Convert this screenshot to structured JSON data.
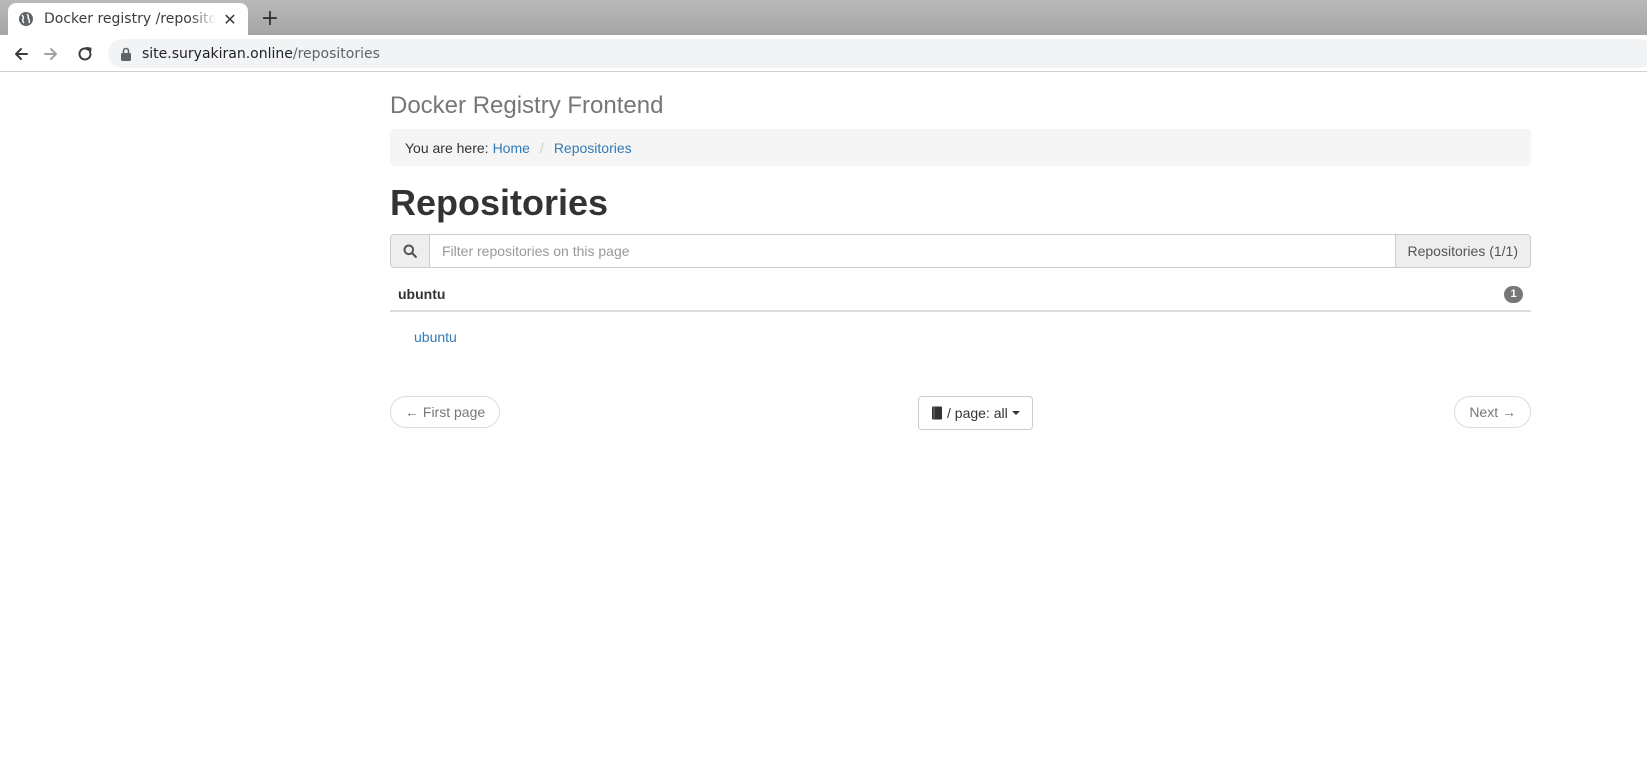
{
  "browser": {
    "tab_title": "Docker registry /repositories",
    "url_host": "site.suryakiran.online",
    "url_path": "/repositories",
    "icons": [
      "globe-icon",
      "close-icon",
      "plus-icon",
      "back-arrow-icon",
      "forward-arrow-icon",
      "reload-icon",
      "lock-icon"
    ]
  },
  "site": {
    "title": "Docker Registry Frontend"
  },
  "breadcrumb": {
    "prefix": "You are here:",
    "items": [
      "Home",
      "Repositories"
    ]
  },
  "page": {
    "heading": "Repositories"
  },
  "filter": {
    "placeholder": "Filter repositories on this page",
    "count_label": "Repositories (1/1)",
    "icon": "search-icon"
  },
  "groups": [
    {
      "name": "ubuntu",
      "count": "1",
      "repositories": [
        "ubuntu"
      ]
    }
  ],
  "pagination": {
    "first_label": "← First page",
    "per_page_label": "/ page: all",
    "next_label": "Next →",
    "per_page_icon": "book-icon"
  },
  "colors": {
    "link": "#337ab7",
    "muted_text": "#777777",
    "breadcrumb_bg": "#f5f5f5",
    "badge_bg": "#777777"
  }
}
